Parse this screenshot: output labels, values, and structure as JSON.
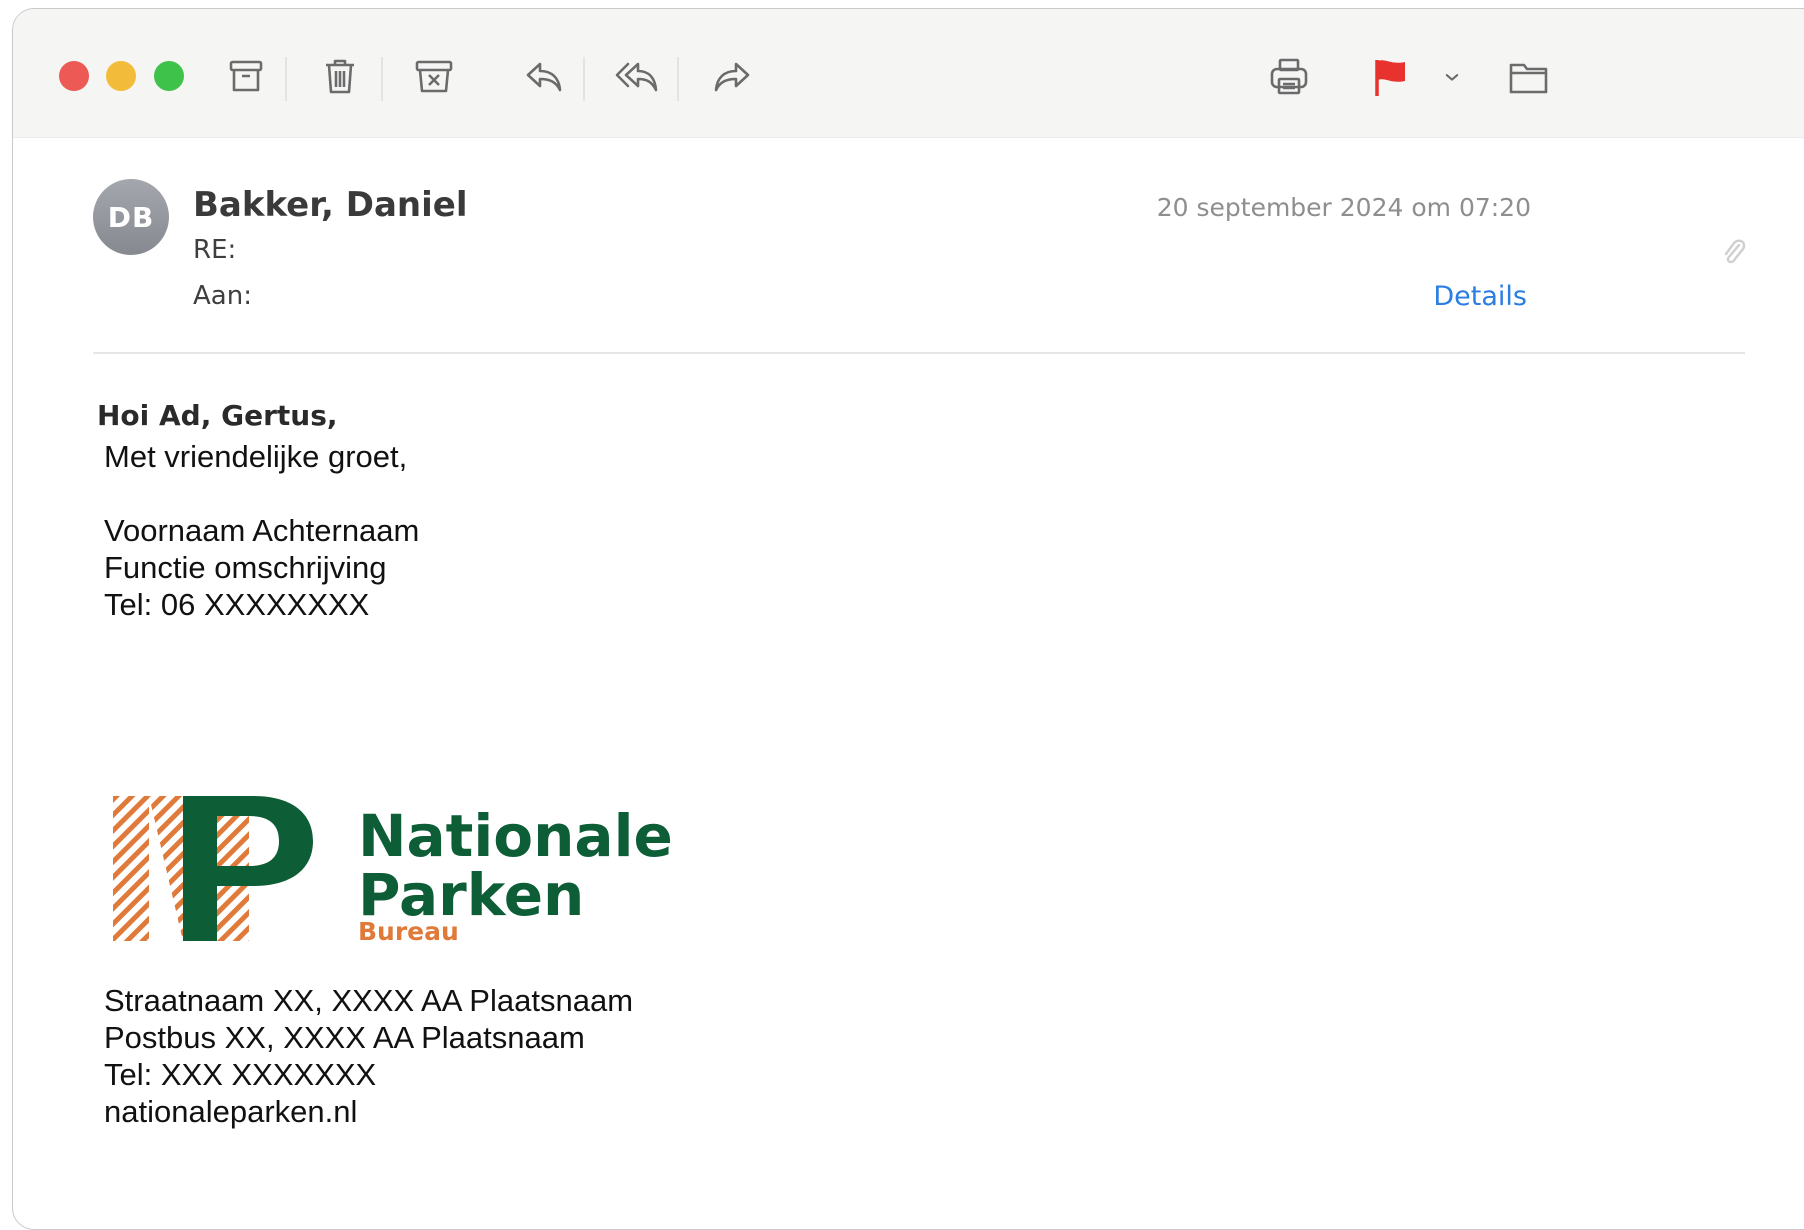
{
  "window": {
    "traffic_lights": [
      "close",
      "minimize",
      "zoom"
    ]
  },
  "toolbar": {
    "icons": [
      "archive-icon",
      "trash-icon",
      "junk-icon",
      "reply-icon",
      "reply-all-icon",
      "forward-icon",
      "print-icon",
      "flag-icon",
      "chevron-down-icon",
      "folder-icon"
    ],
    "flag_color": "#e8322d"
  },
  "message": {
    "avatar_initials": "DB",
    "sender": "Bakker, Daniel",
    "subject": "RE:",
    "to_label": "Aan:",
    "date": "20 september 2024 om 07:20",
    "details_link": "Details",
    "link_color": "#2a7de1"
  },
  "body": {
    "greeting": "Hoi Ad, Gertus,",
    "closing": "Met vriendelijke groet,",
    "signature_name": "Voornaam Achternaam",
    "signature_role": "Functie omschrijving",
    "signature_phone": "Tel: 06 XXXXXXXX"
  },
  "logo": {
    "line1": "Nationale",
    "line2": "Parken",
    "line3": "Bureau",
    "green": "#0d5d36",
    "orange": "#e07a3a"
  },
  "footer": {
    "street": "Straatnaam XX, XXXX AA Plaatsnaam",
    "postbus": "Postbus XX, XXXX AA Plaatsnaam",
    "phone": "Tel: XXX XXXXXXX",
    "website": "nationaleparken.nl"
  }
}
